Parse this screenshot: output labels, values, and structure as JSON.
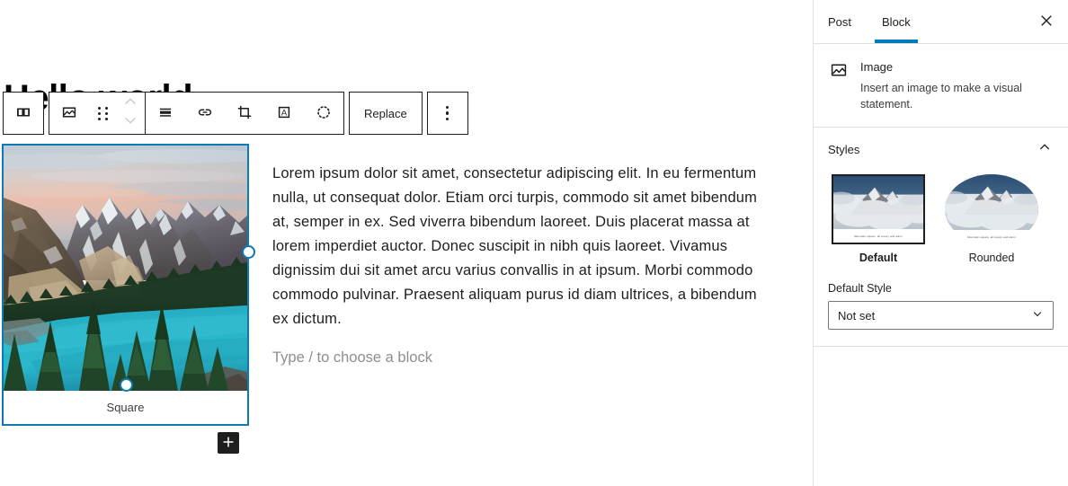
{
  "editor": {
    "post_title": "Hello world",
    "paragraph_text": "Lorem ipsum dolor sit amet, consectetur adipiscing elit. In eu fermentum nulla, ut consequat dolor. Etiam orci turpis, commodo sit amet bibendum at, semper in ex. Sed viverra bibendum laoreet. Duis placerat massa at lorem imperdiet auctor. Donec suscipit in nibh quis laoreet. Vivamus dignissim dui sit amet arcu varius convallis in at ipsum. Morbi commodo commodo pulvinar. Praesent aliquam purus id diam ultrices, a bibendum ex dictum.",
    "empty_block_placeholder": "Type / to choose a block",
    "image_caption": "Square",
    "add_block_label": "+",
    "selection_color": "#0d7ab5"
  },
  "toolbar": {
    "block_type_icon": "block-columns-icon",
    "image_icon": "image-icon",
    "drag_icon": "drag-handle-icon",
    "move_up_icon": "chevron-up-icon",
    "move_down_icon": "chevron-down-icon",
    "align_icon": "align-none-icon",
    "link_icon": "link-icon",
    "crop_icon": "crop-icon",
    "text_over_image_icon": "add-text-over-image-icon",
    "duotone_icon": "duotone-filter-icon",
    "replace_label": "Replace",
    "options_icon": "kebab-menu-icon"
  },
  "sidebar": {
    "tabs": [
      {
        "label": "Post",
        "active": false
      },
      {
        "label": "Block",
        "active": true
      }
    ],
    "accent_color": "#007cba",
    "close_icon": "close-icon",
    "block_card": {
      "icon": "image-icon",
      "title": "Image",
      "description": "Insert an image to make a visual statement."
    },
    "styles_panel": {
      "title": "Styles",
      "collapse_icon": "chevron-up-icon",
      "options": [
        {
          "label": "Default",
          "selected": true,
          "preview_caption": "Mountain square, all snowy and warm"
        },
        {
          "label": "Rounded",
          "selected": false,
          "preview_caption": "Mountain square, all snowy and warm"
        }
      ],
      "default_style_label": "Default Style",
      "default_style_value": "Not set",
      "default_style_chevron": "chevron-down-icon"
    }
  }
}
